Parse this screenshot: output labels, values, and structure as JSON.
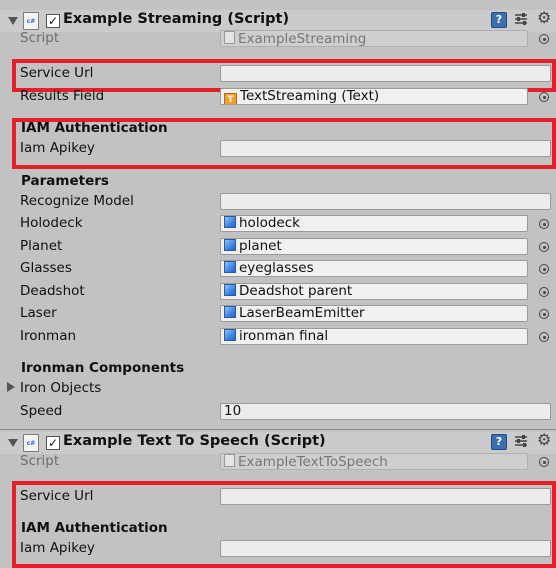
{
  "streaming": {
    "title": "Example Streaming (Script)",
    "fields": {
      "script_label": "Script",
      "script_value": "ExampleStreaming",
      "service_url_label": "Service Url",
      "service_url_value": "",
      "results_field_label": "Results Field",
      "results_field_value": "TextStreaming (Text)",
      "iam_header": "IAM Authentication",
      "iam_apikey_label": "Iam Apikey",
      "iam_apikey_value": "",
      "parameters_header": "Parameters",
      "recognize_model_label": "Recognize Model",
      "recognize_model_value": "",
      "holodeck_label": "Holodeck",
      "holodeck_value": "holodeck",
      "planet_label": "Planet",
      "planet_value": "planet",
      "glasses_label": "Glasses",
      "glasses_value": "eyeglasses",
      "deadshot_label": "Deadshot",
      "deadshot_value": "Deadshot parent",
      "laser_label": "Laser",
      "laser_value": "LaserBeamEmitter",
      "ironman_label": "Ironman",
      "ironman_value": "ironman final",
      "ironman_components_header": "Ironman Components",
      "iron_objects_label": "Iron Objects",
      "speed_label": "Speed",
      "speed_value": "10"
    }
  },
  "tts": {
    "title": "Example Text To Speech (Script)",
    "fields": {
      "script_label": "Script",
      "script_value": "ExampleTextToSpeech",
      "service_url_label": "Service Url",
      "service_url_value": "",
      "iam_header": "IAM Authentication",
      "iam_apikey_label": "Iam Apikey",
      "iam_apikey_value": ""
    }
  },
  "icons": {
    "foldout": "triangle-down-icon",
    "script": "script-cs-icon",
    "help": "help-book-icon",
    "presets": "sliders-icon",
    "settings": "gear-icon",
    "object": "cube-icon",
    "text_component": "text-component-icon",
    "picker": "object-picker-icon"
  },
  "colors": {
    "highlight": "#e3202a",
    "background": "#c2c2c2",
    "header": "#cbcbcb"
  }
}
